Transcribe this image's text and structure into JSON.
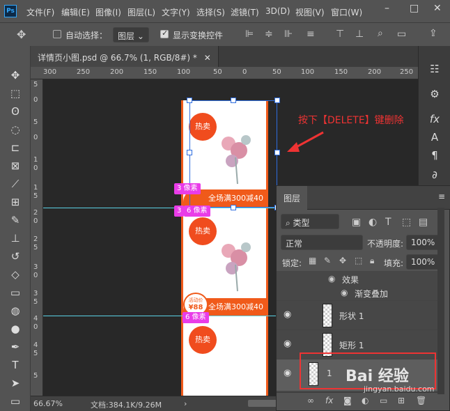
{
  "app": {
    "logo": "Ps"
  },
  "menu": [
    "文件(F)",
    "编辑(E)",
    "图像(I)",
    "图层(L)",
    "文字(Y)",
    "选择(S)",
    "滤镜(T)",
    "3D(D)",
    "视图(V)",
    "窗口(W)"
  ],
  "window_controls": {
    "min": "–",
    "max": "□",
    "close": "✕"
  },
  "options": {
    "auto_select_label": "自动选择：",
    "auto_select_target": "图层",
    "show_transform_label": "显示变换控件"
  },
  "document": {
    "tab_title": "详情页小图.psd @ 66.7% (1, RGB/8#) *",
    "close": "✕",
    "zoom": "66.67%",
    "doc_info": "文档:384.1K/9.26M",
    "arrow": "›"
  },
  "ruler": {
    "h": [
      "300",
      "250",
      "200",
      "150",
      "100",
      "50",
      "0",
      "50",
      "100",
      "150",
      "200",
      "250"
    ],
    "v": [
      "5",
      "0",
      "5",
      "0",
      "1",
      "0",
      "1",
      "5",
      "2",
      "0",
      "2",
      "5",
      "3",
      "0",
      "3",
      "5",
      "4",
      "0",
      "4",
      "5",
      "5"
    ]
  },
  "artwork": {
    "hot_label": "热卖",
    "promo_text": "全场满300减40",
    "badge_88": "¥88",
    "badge_small": "活动价"
  },
  "guides": {
    "tag1": "3 像素",
    "tag2": "6 像素",
    "tag3": "6 像素",
    "tag2_prefix": "3"
  },
  "annotation": "按下【DELETE】键删除",
  "layers_panel": {
    "tab": "图层",
    "kind_filter": "类型",
    "blend_mode": "正常",
    "opacity_label": "不透明度:",
    "opacity_value": "100%",
    "lock_label": "锁定:",
    "fill_label": "填充:",
    "fill_value": "100%",
    "effects_label": "效果",
    "gradient_overlay": "渐变叠加",
    "layers": [
      {
        "name": "形状 1"
      },
      {
        "name": "矩形 1"
      },
      {
        "name": "1"
      }
    ],
    "footer_icons": [
      "link-icon",
      "fx-icon",
      "mask-icon",
      "adjustment-icon",
      "group-icon",
      "new-layer-icon",
      "trash-icon"
    ]
  },
  "watermark": {
    "text": "Bai 经验",
    "url": "jingyan.baidu.com"
  }
}
